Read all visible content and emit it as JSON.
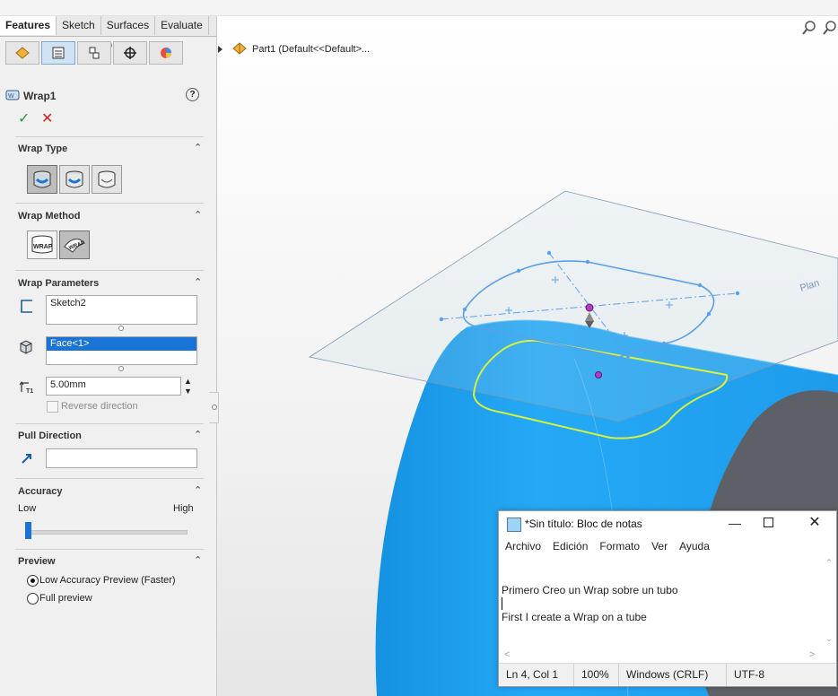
{
  "colors": {
    "tube": "#1fa2f0",
    "tube_end": "#5d6167",
    "sketch": "#5aa0e8",
    "wrap_outline": "#d7f23c",
    "accept": "#2a9a2a",
    "cancel": "#d32020",
    "face_selection": "#1a74d8"
  },
  "tabs": [
    "Features",
    "Sketch",
    "Surfaces",
    "Evaluate"
  ],
  "panel_icons": [
    "feature-manager-icon",
    "property-manager-icon",
    "configuration-manager-icon",
    "dimxpert-icon",
    "display-manager-icon"
  ],
  "feature": {
    "title": "Wrap1",
    "help": "?",
    "accept": "✓",
    "cancel": "✕"
  },
  "wrap_type": {
    "title": "Wrap Type",
    "options": [
      "emboss",
      "deboss",
      "scribe"
    ],
    "selected": "emboss"
  },
  "wrap_method": {
    "title": "Wrap Method",
    "options": [
      "WRAP",
      "WRAP"
    ],
    "selected": 0
  },
  "wrap_parameters": {
    "title": "Wrap Parameters",
    "sketch": "Sketch2",
    "face": "Face<1>",
    "thickness": "5.00mm",
    "reverse_label": "Reverse direction"
  },
  "pull_direction": {
    "title": "Pull Direction",
    "value": ""
  },
  "accuracy": {
    "title": "Accuracy",
    "low": "Low",
    "high": "High",
    "level": 0
  },
  "preview": {
    "title": "Preview",
    "options": [
      "Low Accuracy Preview (Faster)",
      "Full preview"
    ],
    "selected": 0
  },
  "tree": {
    "label": "Part1  (Default<<Default>..."
  },
  "viewport": {
    "plane_label": "Plan"
  },
  "notepad": {
    "title": "*Sin título: Bloc de notas",
    "menu": [
      "Archivo",
      "Edición",
      "Formato",
      "Ver",
      "Ayuda"
    ],
    "lines": [
      "Primero Creo un Wrap sobre un tubo",
      "",
      "First I create a Wrap on a tube"
    ],
    "status": {
      "position": "Ln 4, Col 1",
      "zoom": "100%",
      "eol": "Windows (CRLF)",
      "encoding": "UTF-8"
    }
  }
}
